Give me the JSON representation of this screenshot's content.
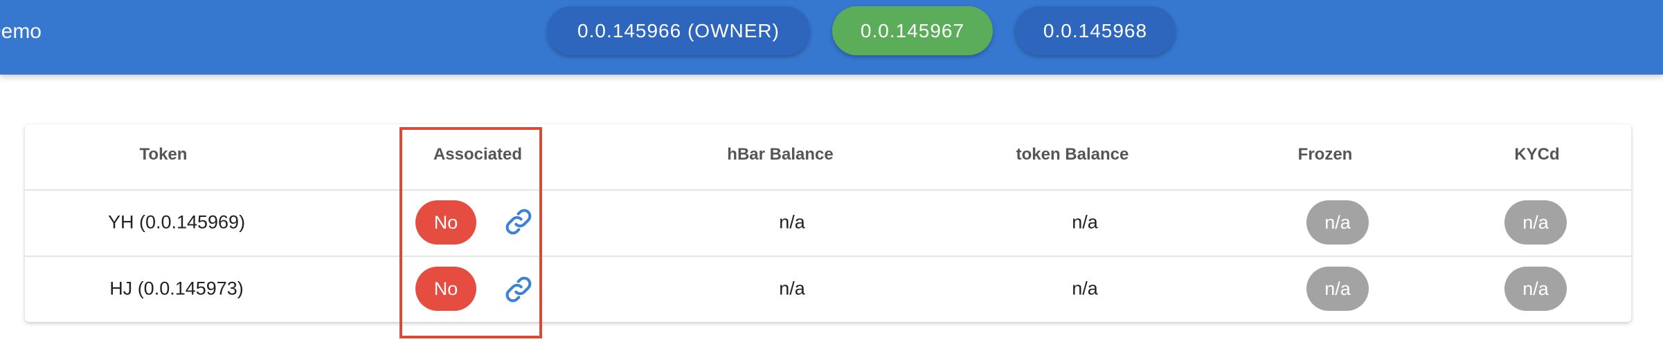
{
  "header": {
    "app_title": "Demo",
    "accounts": [
      {
        "label": "0.0.145966 (OWNER)",
        "state": "default"
      },
      {
        "label": "0.0.145967",
        "state": "selected"
      },
      {
        "label": "0.0.145968",
        "state": "default"
      }
    ]
  },
  "table": {
    "columns": [
      "Token",
      "Associated",
      "hBar Balance",
      "token Balance",
      "Frozen",
      "KYCd"
    ],
    "rows": [
      {
        "token": "YH (0.0.145969)",
        "associated": "No",
        "hbar_balance": "n/a",
        "token_balance": "n/a",
        "frozen": "n/a",
        "kycd": "n/a"
      },
      {
        "token": "HJ (0.0.145973)",
        "associated": "No",
        "hbar_balance": "n/a",
        "token_balance": "n/a",
        "frozen": "n/a",
        "kycd": "n/a"
      }
    ]
  },
  "icons": {
    "associate_action": "link-icon"
  },
  "colors": {
    "topbar": "#3677cf",
    "account_button": "#2d66bc",
    "account_selected": "#5cad5a",
    "associated_no": "#e54d40",
    "status_na": "#a3a3a3",
    "link_icon": "#3b82d6",
    "highlight": "#dd4a34"
  }
}
